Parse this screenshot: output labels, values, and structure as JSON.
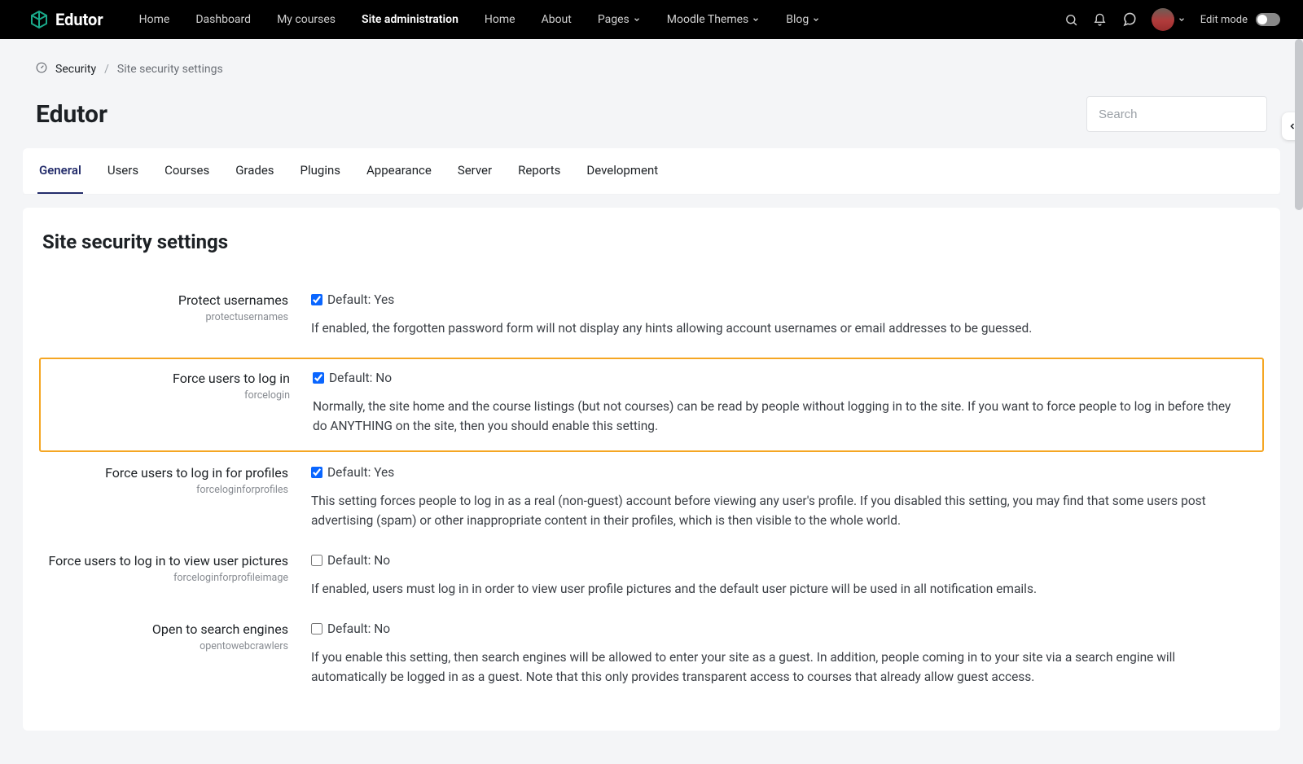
{
  "brand": "Edutor",
  "nav": [
    {
      "label": "Home"
    },
    {
      "label": "Dashboard"
    },
    {
      "label": "My courses"
    },
    {
      "label": "Site administration",
      "active": true
    },
    {
      "label": "Home"
    },
    {
      "label": "About"
    },
    {
      "label": "Pages",
      "dropdown": true
    },
    {
      "label": "Moodle Themes",
      "dropdown": true
    },
    {
      "label": "Blog",
      "dropdown": true
    }
  ],
  "edit_mode_label": "Edit mode",
  "breadcrumb": {
    "root": "Security",
    "current": "Site security settings"
  },
  "page_title": "Edutor",
  "search": {
    "placeholder": "Search"
  },
  "tabs": [
    "General",
    "Users",
    "Courses",
    "Grades",
    "Plugins",
    "Appearance",
    "Server",
    "Reports",
    "Development"
  ],
  "active_tab": "General",
  "section_heading": "Site security settings",
  "settings": [
    {
      "label": "Protect usernames",
      "slug": "protectusernames",
      "checked": true,
      "default": "Default: Yes",
      "desc": "If enabled, the forgotten password form will not display any hints allowing account usernames or email addresses to be guessed.",
      "highlight": false
    },
    {
      "label": "Force users to log in",
      "slug": "forcelogin",
      "checked": true,
      "default": "Default: No",
      "desc": "Normally, the site home and the course listings (but not courses) can be read by people without logging in to the site. If you want to force people to log in before they do ANYTHING on the site, then you should enable this setting.",
      "highlight": true
    },
    {
      "label": "Force users to log in for profiles",
      "slug": "forceloginforprofiles",
      "checked": true,
      "default": "Default: Yes",
      "desc": "This setting forces people to log in as a real (non-guest) account before viewing any user's profile. If you disabled this setting, you may find that some users post advertising (spam) or other inappropriate content in their profiles, which is then visible to the whole world.",
      "highlight": false
    },
    {
      "label": "Force users to log in to view user pictures",
      "slug": "forceloginforprofileimage",
      "checked": false,
      "default": "Default: No",
      "desc": "If enabled, users must log in in order to view user profile pictures and the default user picture will be used in all notification emails.",
      "highlight": false
    },
    {
      "label": "Open to search engines",
      "slug": "opentowebcrawlers",
      "checked": false,
      "default": "Default: No",
      "desc": "If you enable this setting, then search engines will be allowed to enter your site as a guest. In addition, people coming in to your site via a search engine will automatically be logged in as a guest. Note that this only provides transparent access to courses that already allow guest access.",
      "highlight": false
    }
  ]
}
